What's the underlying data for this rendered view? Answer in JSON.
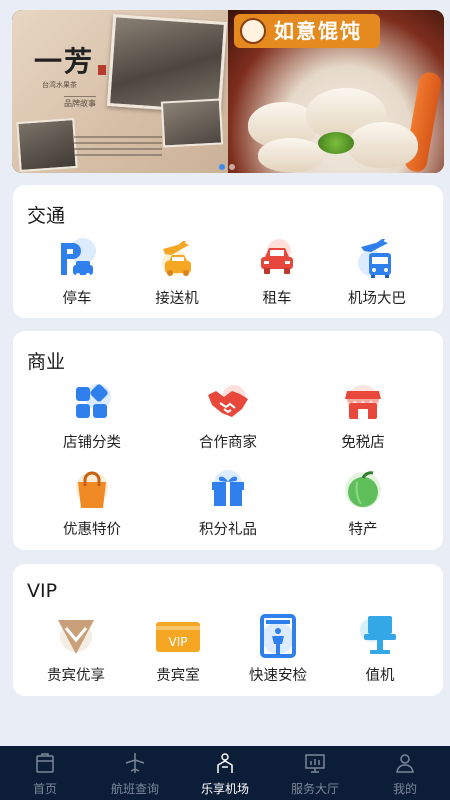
{
  "banner": {
    "left_title": "一芳",
    "left_subtitle": "台湾水果茶",
    "left_tag": "品牌故事",
    "right_logo": "如意馄饨",
    "active_slide": 1,
    "slide_count": 2
  },
  "sections": {
    "traffic": {
      "title": "交通",
      "items": [
        {
          "label": "停车",
          "icon": "parking-icon"
        },
        {
          "label": "接送机",
          "icon": "airport-taxi-icon"
        },
        {
          "label": "租车",
          "icon": "car-rental-icon"
        },
        {
          "label": "机场大巴",
          "icon": "airport-bus-icon"
        }
      ]
    },
    "commerce": {
      "title": "商业",
      "items": [
        {
          "label": "店铺分类",
          "icon": "category-icon"
        },
        {
          "label": "合作商家",
          "icon": "handshake-icon"
        },
        {
          "label": "免税店",
          "icon": "storefront-icon"
        },
        {
          "label": "优惠特价",
          "icon": "shopping-bag-icon"
        },
        {
          "label": "积分礼品",
          "icon": "gift-icon"
        },
        {
          "label": "特产",
          "icon": "fruit-icon"
        }
      ]
    },
    "vip": {
      "title": "VIP",
      "items": [
        {
          "label": "贵宾优享",
          "icon": "vip-diamond-icon"
        },
        {
          "label": "贵宾室",
          "icon": "vip-card-icon",
          "badge": "VIP"
        },
        {
          "label": "快速安检",
          "icon": "security-gate-icon"
        },
        {
          "label": "值机",
          "icon": "check-in-kiosk-icon"
        }
      ]
    }
  },
  "tabbar": {
    "tabs": [
      {
        "label": "首页",
        "icon": "home-icon"
      },
      {
        "label": "航班查询",
        "icon": "airplane-icon"
      },
      {
        "label": "乐享机场",
        "icon": "airport-service-icon",
        "active": true
      },
      {
        "label": "服务大厅",
        "icon": "service-hall-icon"
      },
      {
        "label": "我的",
        "icon": "profile-icon"
      }
    ]
  },
  "colors": {
    "accent_blue": "#2f80ed",
    "accent_orange": "#f5a623",
    "accent_red": "#e8473b",
    "nav_bg": "#0c1e37",
    "page_bg": "#e9edf5"
  }
}
